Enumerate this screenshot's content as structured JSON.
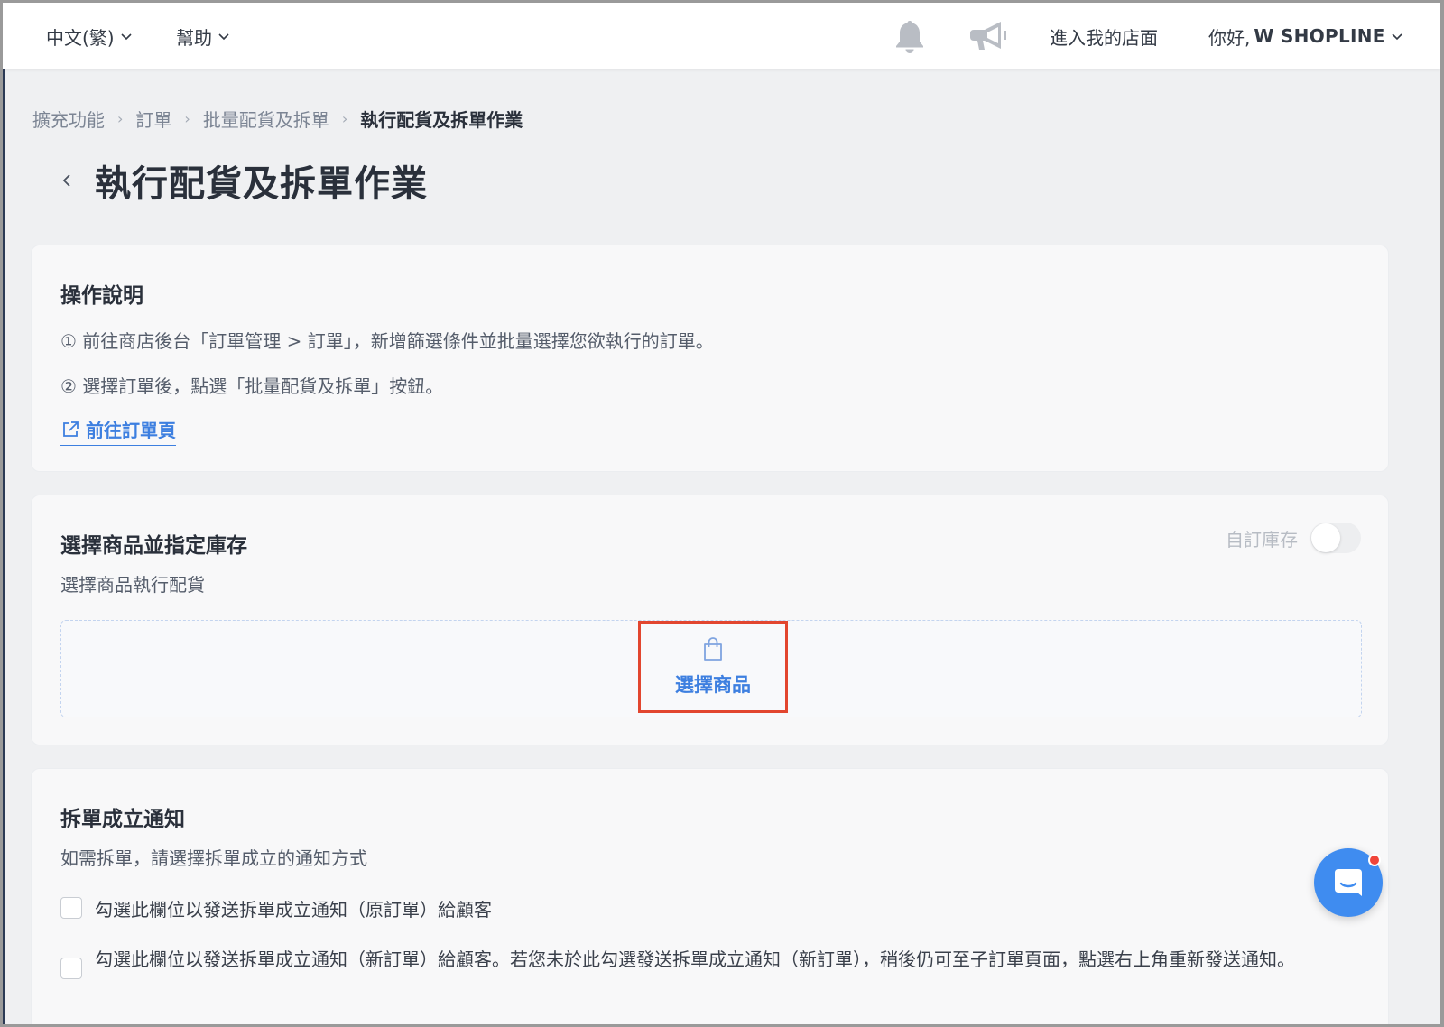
{
  "topbar": {
    "language": "中文(繁)",
    "help": "幫助",
    "bell_icon": "bell-icon",
    "announce_icon": "megaphone-icon",
    "store_link": "進入我的店面",
    "greeting": "你好,",
    "user_name": "W SHOPLINE"
  },
  "breadcrumb": {
    "items": [
      "擴充功能",
      "訂單",
      "批量配貨及拆單"
    ],
    "current": "執行配貨及拆單作業"
  },
  "page": {
    "title": "執行配貨及拆單作業"
  },
  "instructions": {
    "title": "操作說明",
    "step1": "① 前往商店後台「訂單管理 > 訂單」，新增篩選條件並批量選擇您欲執行的訂單。",
    "step2": "② 選擇訂單後，點選「批量配貨及拆單」按鈕。",
    "link": "前往訂單頁"
  },
  "product_section": {
    "title": "選擇商品並指定庫存",
    "subtitle": "選擇商品執行配貨",
    "toggle_label": "自訂庫存",
    "toggle_on": false,
    "select_button": "選擇商品"
  },
  "notify_section": {
    "title": "拆單成立通知",
    "subtitle": "如需拆單，請選擇拆單成立的通知方式",
    "option1": "勾選此欄位以發送拆單成立通知（原訂單）給顧客",
    "option2": "勾選此欄位以發送拆單成立通知（新訂單）給顧客。若您未於此勾選發送拆單成立通知（新訂單），稍後仍可至子訂單頁面，點選右上角重新發送通知。",
    "option1_checked": false,
    "option2_checked": false
  },
  "colors": {
    "accent": "#3d7fe0",
    "highlight_border": "#e2462f",
    "chat_button": "#3f8cf0"
  }
}
